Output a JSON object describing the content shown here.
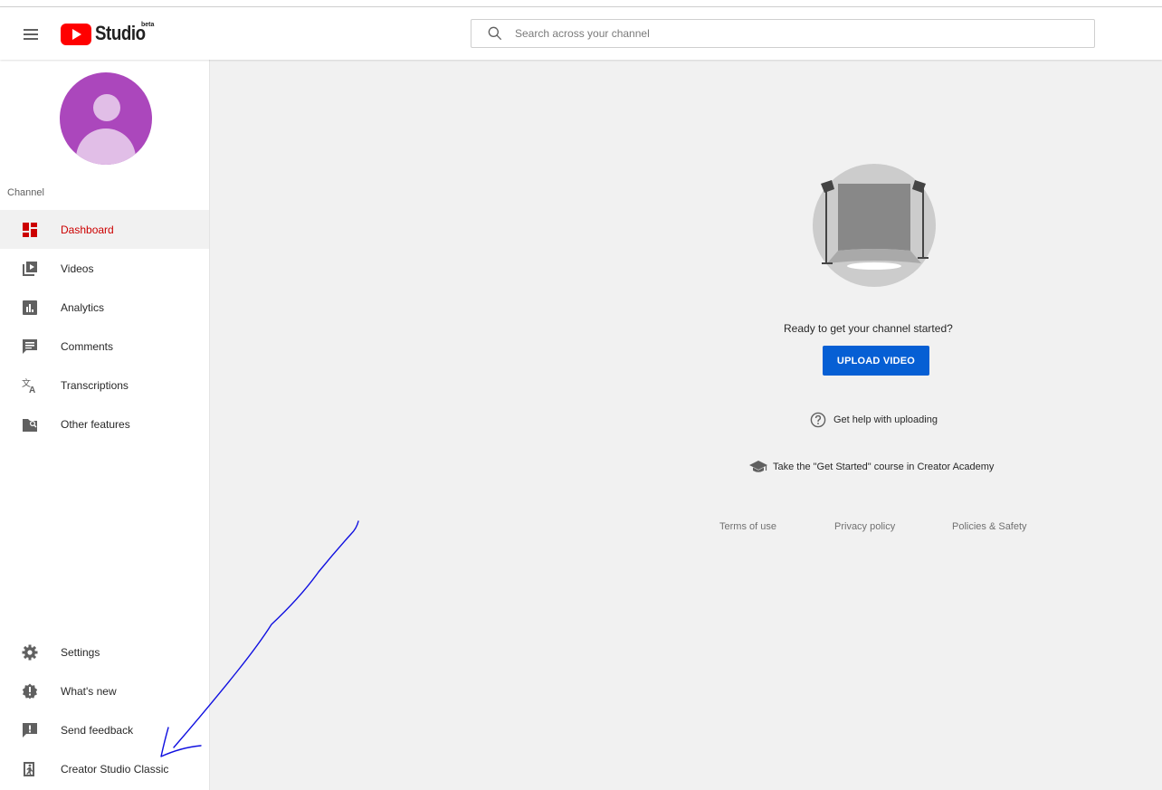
{
  "header": {
    "logo_text": "Studio",
    "logo_badge": "beta",
    "search_placeholder": "Search across your channel"
  },
  "sidebar": {
    "section_label": "Channel",
    "items": [
      {
        "label": "Dashboard",
        "icon": "dashboard-icon",
        "active": true
      },
      {
        "label": "Videos",
        "icon": "videos-icon"
      },
      {
        "label": "Analytics",
        "icon": "analytics-icon"
      },
      {
        "label": "Comments",
        "icon": "comments-icon"
      },
      {
        "label": "Transcriptions",
        "icon": "translate-icon"
      },
      {
        "label": "Other features",
        "icon": "other-features-icon"
      }
    ],
    "bottom_items": [
      {
        "label": "Settings",
        "icon": "gear-icon"
      },
      {
        "label": "What's new",
        "icon": "whats-new-icon"
      },
      {
        "label": "Send feedback",
        "icon": "feedback-icon"
      },
      {
        "label": "Creator Studio Classic",
        "icon": "exit-icon"
      }
    ]
  },
  "main": {
    "ready_text": "Ready to get your channel started?",
    "upload_button": "UPLOAD VIDEO",
    "help_link": "Get help with uploading",
    "academy_link": "Take the \"Get Started\" course in Creator Academy",
    "footer": {
      "terms": "Terms of use",
      "privacy": "Privacy policy",
      "policies": "Policies & Safety"
    }
  },
  "colors": {
    "accent_red": "#cc0000",
    "youtube_red": "#ff0000",
    "upload_blue": "#065fd4",
    "avatar_purple": "#ab47bc",
    "annotation_blue": "#1010e0"
  }
}
